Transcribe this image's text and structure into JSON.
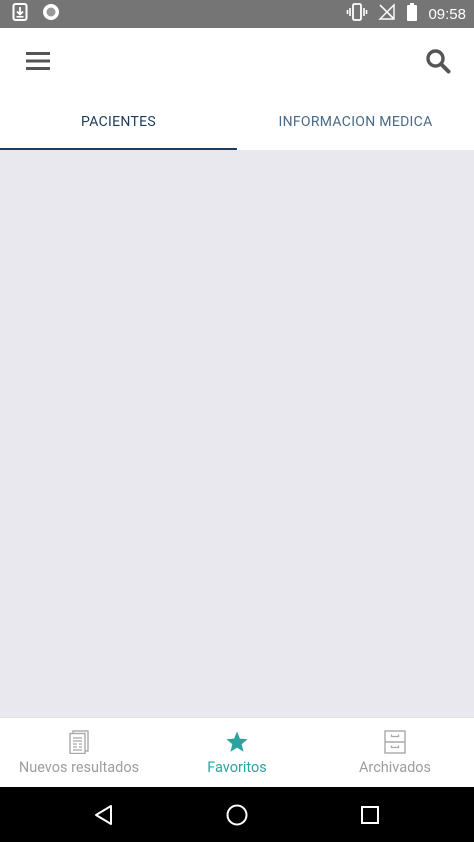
{
  "status_bar": {
    "time": "09:58"
  },
  "app_bar": {
    "menu_icon": "menu-icon",
    "search_icon": "search-icon"
  },
  "tabs": [
    {
      "label": "PACIENTES",
      "active": true
    },
    {
      "label": "INFORMACION MEDICA",
      "active": false
    }
  ],
  "bottom_nav": {
    "items": [
      {
        "label": "Nuevos resultados",
        "icon": "document-icon",
        "active": false
      },
      {
        "label": "Favoritos",
        "icon": "star-icon",
        "active": true
      },
      {
        "label": "Archivados",
        "icon": "archive-icon",
        "active": false
      }
    ]
  },
  "colors": {
    "status_bar": "#757575",
    "tab_active": "#1f3b5a",
    "tab_inactive": "#4a6a88",
    "content_bg": "#e8e8ee",
    "nav_active": "#2aa3a1",
    "nav_inactive": "#9e9e9e"
  }
}
